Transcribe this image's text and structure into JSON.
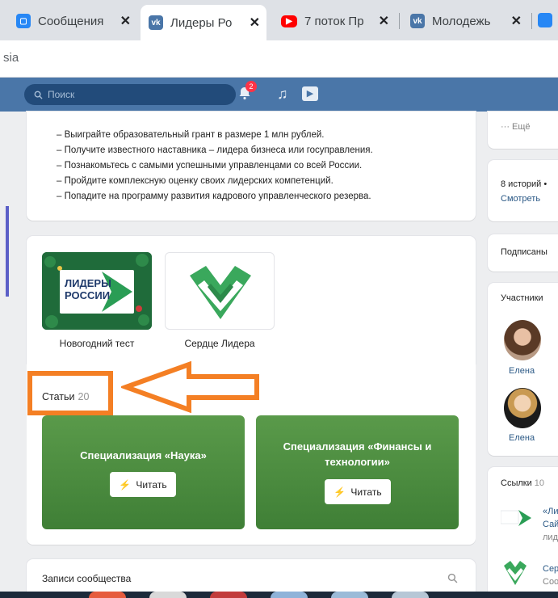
{
  "browser": {
    "tabs": [
      {
        "title": "Сообщения",
        "active": false,
        "favicon": "vk-messages-icon",
        "color": "#2787f5"
      },
      {
        "title": "Лидеры Ро",
        "active": true,
        "favicon": "vk-icon",
        "color": "#4a76a8"
      },
      {
        "title": "7 поток Пр",
        "active": false,
        "favicon": "youtube-icon",
        "color": "#ff0000"
      },
      {
        "title": "Молодежь",
        "active": false,
        "favicon": "vk-icon",
        "color": "#4a76a8"
      }
    ],
    "address_partial": "sia"
  },
  "vk_header": {
    "search_placeholder": "Поиск",
    "notifications_count": "2",
    "accent": "#4a76a8"
  },
  "intro": {
    "bullets": [
      "– Выиграйте образовательный грант в размере 1 млн рублей.",
      "– Получите известного наставника – лидера бизнеса или госуправления.",
      "– Познакомьтесь с самыми успешными управленцами со всей России.",
      "– Пройдите комплексную оценку своих лидерских компетенций.",
      "– Попадите на программу развития кадрового управленческого резерва."
    ]
  },
  "apps": [
    {
      "name": "Новогодний тест",
      "logo_text_1": "ЛИДЕРЫ",
      "logo_text_2": "РОССИИ"
    },
    {
      "name": "Сердце Лидера"
    }
  ],
  "articles": {
    "title": "Статьи",
    "count": "20",
    "items": [
      {
        "title": "Специализация «Наука»",
        "button": "Читать"
      },
      {
        "title": "Специализация «Финансы и технологии»",
        "button": "Читать"
      }
    ],
    "highlight_color": "#f47f24"
  },
  "community_posts": {
    "title": "Записи сообщества"
  },
  "right_column": {
    "more_label": "Ещё",
    "stories_label": "8 историй •",
    "stories_link": "Смотреть",
    "subscribed_label": "Подписаны",
    "members_label": "Участники",
    "members": [
      {
        "name": "Елена"
      },
      {
        "name": "Елена"
      }
    ],
    "links_label": "Ссылки",
    "links_count": "10",
    "link_items": [
      {
        "line1": "«Ли",
        "line2": "Сай",
        "line3": "лид"
      },
      {
        "line1": "Сер",
        "line2": "Соо"
      }
    ]
  }
}
